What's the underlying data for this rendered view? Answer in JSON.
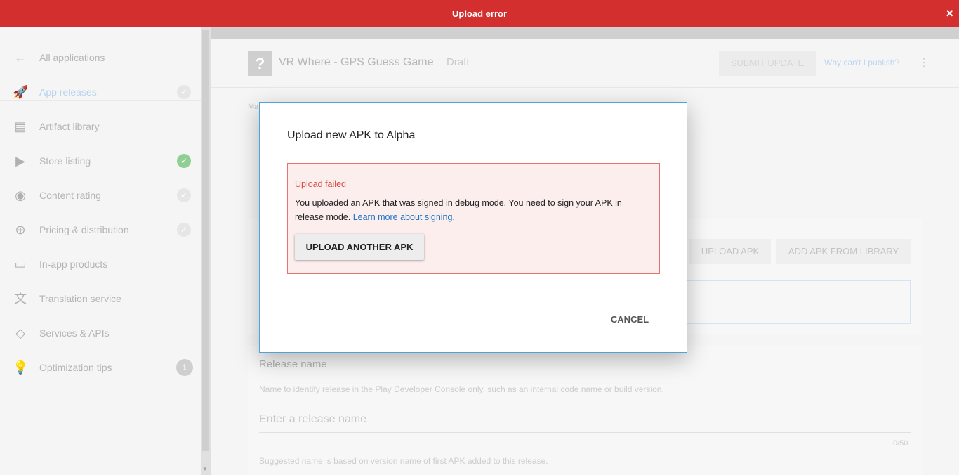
{
  "error_bar": {
    "title": "Upload error",
    "close": "×"
  },
  "sidebar": {
    "items": [
      {
        "label": "All applications",
        "icon": "←"
      },
      {
        "label": "App releases",
        "icon": "🚀",
        "check": "✓"
      },
      {
        "label": "Artifact library",
        "icon": "▤"
      },
      {
        "label": "Store listing",
        "icon": "▶",
        "check": "✓"
      },
      {
        "label": "Content rating",
        "icon": "◉",
        "check": "✓"
      },
      {
        "label": "Pricing & distribution",
        "icon": "⊕",
        "check": "✓"
      },
      {
        "label": "In-app products",
        "icon": "▭"
      },
      {
        "label": "Translation service",
        "icon": "文"
      },
      {
        "label": "Services & APIs",
        "icon": "◇"
      },
      {
        "label": "Optimization tips",
        "icon": "💡",
        "badge": "1"
      }
    ]
  },
  "header": {
    "app_icon": "?",
    "app_name": "VR Where - GPS Guess Game",
    "status": "Draft",
    "submit": "SUBMIT UPDATE",
    "why_link": "Why can't I publish?",
    "more": "⋮"
  },
  "breadcrumb": "Ma",
  "apk_card": {
    "upload_apk": "UPLOAD APK",
    "add_from_library": "ADD APK FROM LIBRARY"
  },
  "release": {
    "title": "Release name",
    "description": "Name to identify release in the Play Developer Console only, such as an internal code name or build version.",
    "placeholder": "Enter a release name",
    "counter": "0/50",
    "suggestion": "Suggested name is based on version name of first APK added to this release."
  },
  "dialog": {
    "title": "Upload new APK to Alpha",
    "error_title": "Upload failed",
    "error_message": "You uploaded an APK that was signed in debug mode. You need to sign your APK in release mode.",
    "learn_more": "Learn more about signing",
    "period": ".",
    "upload_another": "UPLOAD ANOTHER APK",
    "cancel": "CANCEL"
  }
}
